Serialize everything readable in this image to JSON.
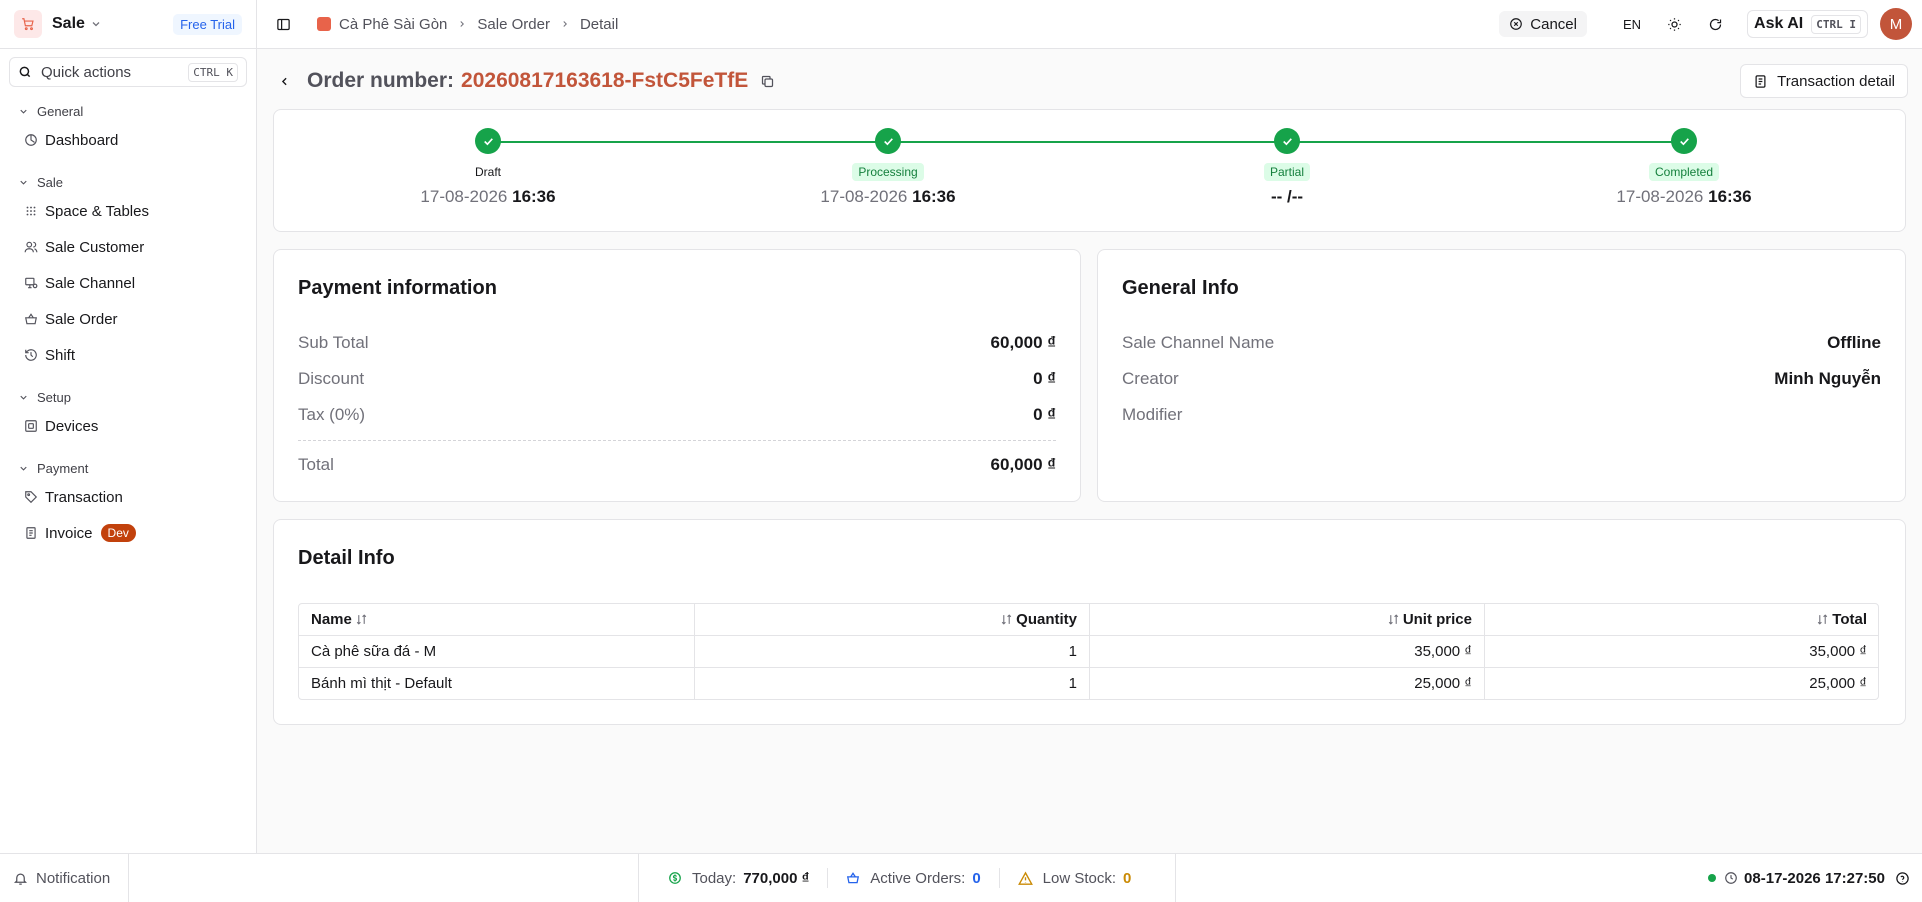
{
  "sidebar": {
    "app_name": "Sale",
    "trial_badge": "Free Trial",
    "quick_actions": {
      "label": "Quick actions",
      "shortcut": "CTRL K"
    },
    "groups": [
      {
        "title": "General",
        "items": [
          {
            "label": "Dashboard",
            "icon": "dashboard-icon"
          }
        ]
      },
      {
        "title": "Sale",
        "items": [
          {
            "label": "Space & Tables",
            "icon": "grid-icon"
          },
          {
            "label": "Sale Customer",
            "icon": "users-icon"
          },
          {
            "label": "Sale Channel",
            "icon": "channel-icon"
          },
          {
            "label": "Sale Order",
            "icon": "basket-icon"
          },
          {
            "label": "Shift",
            "icon": "history-icon"
          }
        ]
      },
      {
        "title": "Setup",
        "items": [
          {
            "label": "Devices",
            "icon": "devices-icon"
          }
        ]
      },
      {
        "title": "Payment",
        "items": [
          {
            "label": "Transaction",
            "icon": "tag-icon"
          },
          {
            "label": "Invoice",
            "icon": "invoice-icon",
            "badge": "Dev"
          }
        ]
      }
    ]
  },
  "header": {
    "breadcrumb": [
      "Cà Phê Sài Gòn",
      "Sale Order",
      "Detail"
    ],
    "cancel_label": "Cancel",
    "language": "EN",
    "ask_ai": {
      "label": "Ask AI",
      "shortcut": "CTRL I"
    },
    "avatar_initial": "M"
  },
  "order": {
    "label": "Order number:",
    "number": "20260817163618-FstC5FeTfE",
    "transaction_detail_label": "Transaction detail"
  },
  "progress": {
    "steps": [
      {
        "label": "Draft",
        "date": "17-08-2026",
        "time": "16:36",
        "highlight": false
      },
      {
        "label": "Processing",
        "date": "17-08-2026",
        "time": "16:36",
        "highlight": true
      },
      {
        "label": "Partial",
        "date": "",
        "time": "-- /--",
        "highlight": true
      },
      {
        "label": "Completed",
        "date": "17-08-2026",
        "time": "16:36",
        "highlight": true
      }
    ]
  },
  "payment": {
    "title": "Payment information",
    "sub_total": {
      "label": "Sub Total",
      "value": "60,000 ₫"
    },
    "discount": {
      "label": "Discount",
      "value": "0 ₫"
    },
    "tax": {
      "label": "Tax (0%)",
      "value": "0 ₫"
    },
    "total": {
      "label": "Total",
      "value": "60,000 ₫"
    }
  },
  "general": {
    "title": "General Info",
    "channel": {
      "label": "Sale Channel Name",
      "value": "Offline"
    },
    "creator": {
      "label": "Creator",
      "value": "Minh Nguyễn"
    },
    "modifier": {
      "label": "Modifier",
      "value": ""
    }
  },
  "detail": {
    "title": "Detail Info",
    "columns": [
      "Name",
      "Quantity",
      "Unit price",
      "Total"
    ],
    "rows": [
      [
        "Cà phê sữa đá - M",
        "1",
        "35,000 ₫",
        "35,000 ₫"
      ],
      [
        "Bánh mì thịt - Default",
        "1",
        "25,000 ₫",
        "25,000 ₫"
      ]
    ]
  },
  "footer": {
    "notification": "Notification",
    "today": {
      "label": "Today:",
      "value": "770,000 ₫"
    },
    "active_orders": {
      "label": "Active Orders:",
      "value": "0"
    },
    "low_stock": {
      "label": "Low Stock:",
      "value": "0"
    },
    "datetime": "08-17-2026 17:27:50"
  },
  "colors": {
    "accent": "#c2553a",
    "success": "#16a34a",
    "info": "#2563eb",
    "warning": "#ca8a04"
  }
}
